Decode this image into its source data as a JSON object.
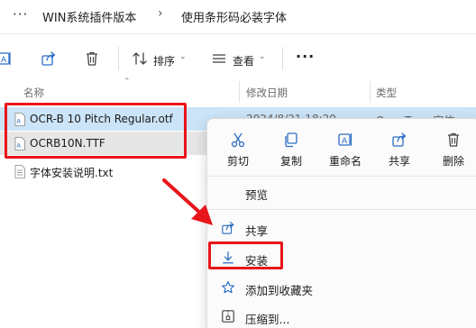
{
  "breadcrumb": {
    "more": "···",
    "items": [
      "WIN系统插件版本",
      "使用条形码必装字体"
    ],
    "separator": "›"
  },
  "toolbar": {
    "sort_label": "排序",
    "view_label": "查看",
    "more": "···",
    "icons": [
      "rename-icon",
      "share-icon",
      "delete-icon",
      "sort-icon",
      "view-icon"
    ]
  },
  "columns": {
    "name": "名称",
    "modified": "修改日期",
    "type": "类型"
  },
  "files": [
    {
      "name": "OCR-B 10 Pitch Regular.otf",
      "date": "2024/8/21 18:20",
      "type": "OpenType 字体",
      "selected": true
    },
    {
      "name": "OCRB10N.TTF",
      "date": "",
      "type": "",
      "selected": true
    },
    {
      "name": "字体安装说明.txt",
      "date": "",
      "type": "",
      "selected": false
    }
  ],
  "context_menu": {
    "quick_actions": [
      {
        "label": "剪切",
        "icon": "cut-icon"
      },
      {
        "label": "复制",
        "icon": "copy-icon"
      },
      {
        "label": "重命名",
        "icon": "rename-icon"
      },
      {
        "label": "共享",
        "icon": "share-icon"
      },
      {
        "label": "删除",
        "icon": "delete-icon"
      }
    ],
    "items": [
      {
        "label": "预览",
        "icon": ""
      },
      {
        "label": "共享",
        "icon": "share-icon"
      },
      {
        "label": "安装",
        "icon": "install-icon"
      },
      {
        "label": "添加到收藏夹",
        "icon": "star-icon"
      },
      {
        "label": "压缩到...",
        "icon": "zip-icon"
      }
    ]
  },
  "colors": {
    "highlight_red": "#e8151b",
    "selection_blue": "#cce4f7",
    "accent": "#0067c0"
  }
}
